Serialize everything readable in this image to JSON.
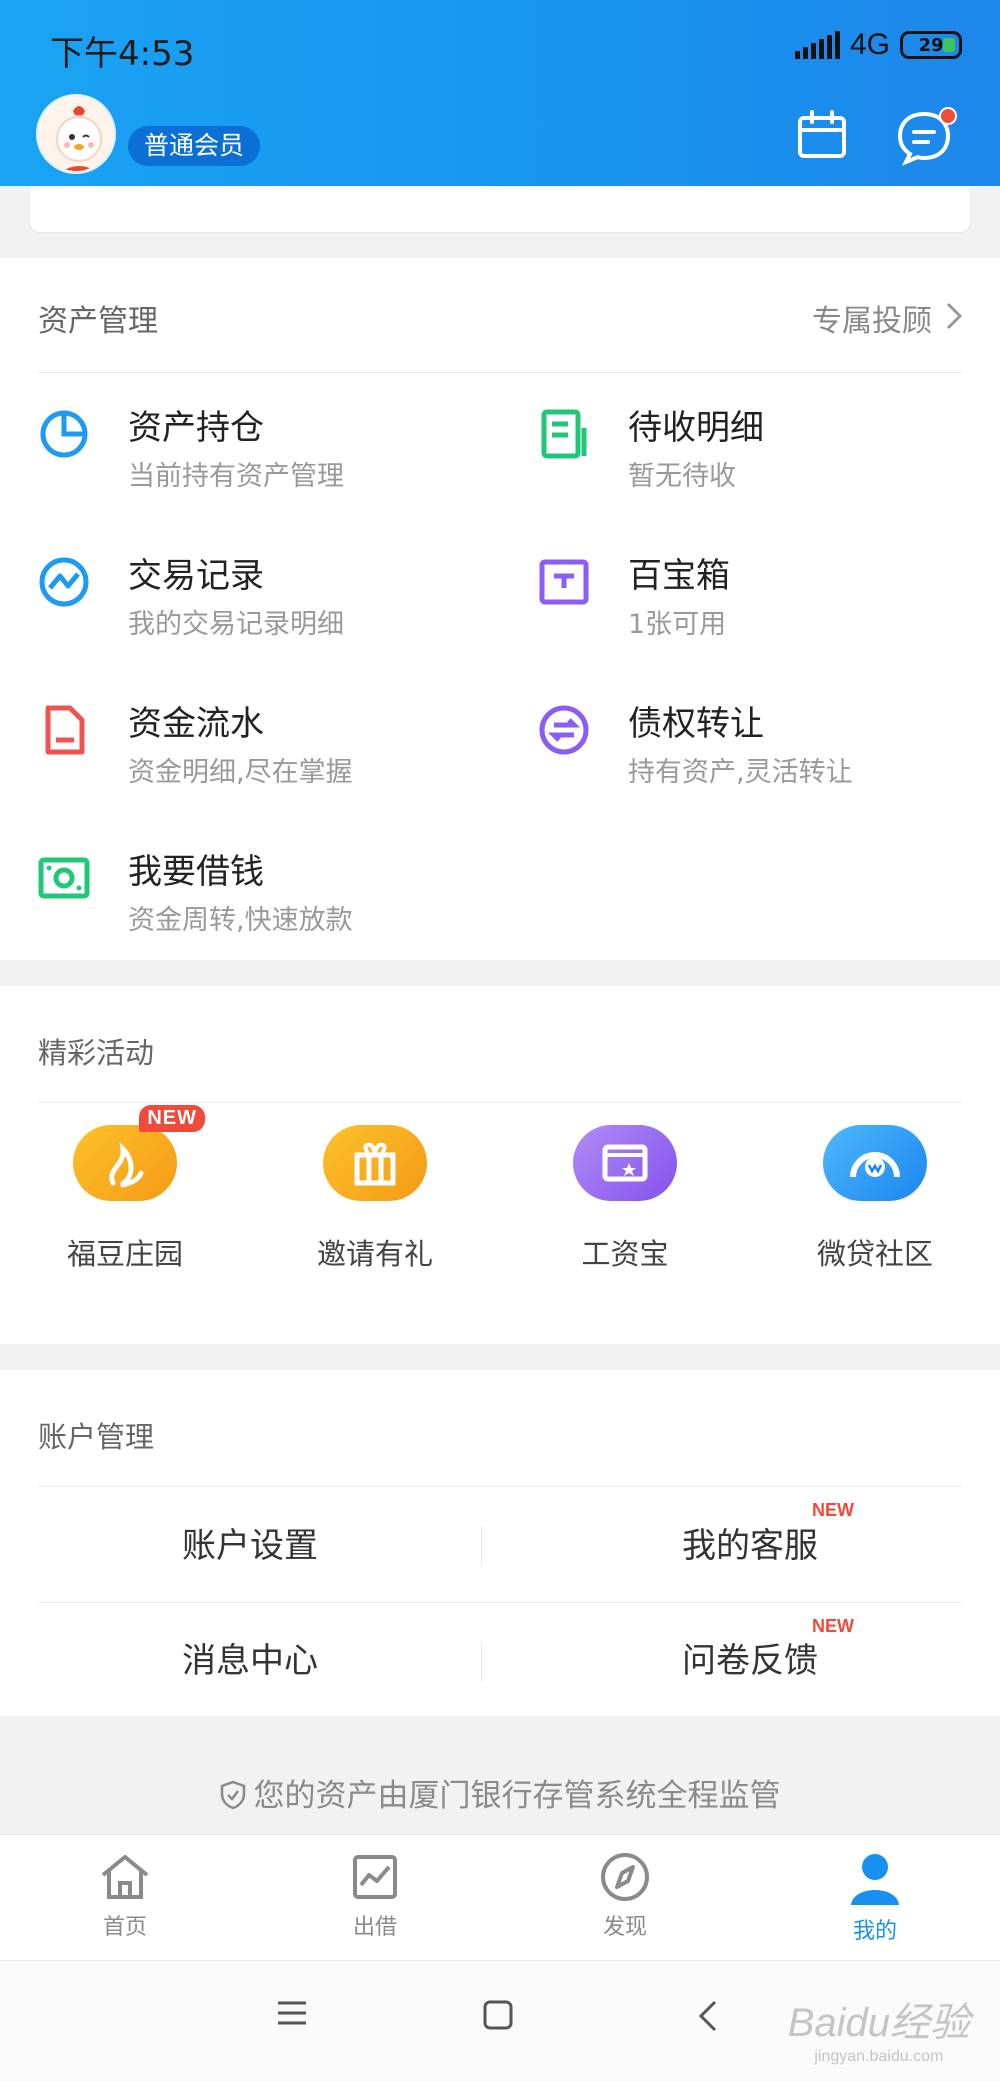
{
  "status_bar": {
    "time": "下午4:53",
    "network": "4G",
    "battery": "29"
  },
  "header": {
    "member_badge": "普通会员"
  },
  "asset_section": {
    "title": "资产管理",
    "advisor_link": "专属投顾",
    "items": [
      {
        "title": "资产持仓",
        "subtitle": "当前持有资产管理",
        "icon": "pie-chart-icon",
        "color": "#1e9bf0"
      },
      {
        "title": "待收明细",
        "subtitle": "暂无待收",
        "icon": "document-list-icon",
        "color": "#20c777"
      },
      {
        "title": "交易记录",
        "subtitle": "我的交易记录明细",
        "icon": "trend-line-icon",
        "color": "#1e9bf0"
      },
      {
        "title": "百宝箱",
        "subtitle": "1张可用",
        "icon": "coupon-box-icon",
        "color": "#8b5cf6"
      },
      {
        "title": "资金流水",
        "subtitle": "资金明细,尽在掌握",
        "icon": "file-icon",
        "color": "#ef5350"
      },
      {
        "title": "债权转让",
        "subtitle": "持有资产,灵活转让",
        "icon": "transfer-arrows-icon",
        "color": "#8b5cf6"
      },
      {
        "title": "我要借钱",
        "subtitle": "资金周转,快速放款",
        "icon": "cash-icon",
        "color": "#20c777"
      }
    ]
  },
  "activity_section": {
    "title": "精彩活动",
    "items": [
      {
        "label": "福豆庄园",
        "icon": "bean-farm-icon",
        "badge": "NEW",
        "color": "#f7a81b"
      },
      {
        "label": "邀请有礼",
        "icon": "gift-icon",
        "color": "#f7a81b"
      },
      {
        "label": "工资宝",
        "icon": "salary-card-icon",
        "color": "#9b6cf0"
      },
      {
        "label": "微贷社区",
        "icon": "community-icon",
        "color": "#1e9bf0"
      }
    ]
  },
  "account_section": {
    "title": "账户管理",
    "items": [
      {
        "label": "账户设置"
      },
      {
        "label": "我的客服",
        "badge": "NEW"
      },
      {
        "label": "消息中心"
      },
      {
        "label": "问卷反馈",
        "badge": "NEW"
      }
    ]
  },
  "footer_note": "您的资产由厦门银行存管系统全程监管",
  "tabbar": {
    "items": [
      {
        "label": "首页",
        "icon": "home-icon"
      },
      {
        "label": "出借",
        "icon": "chart-icon"
      },
      {
        "label": "发现",
        "icon": "compass-icon"
      },
      {
        "label": "我的",
        "icon": "user-icon",
        "active": true
      }
    ]
  },
  "colors": {
    "brand_blue": "#1795ee",
    "accent_red": "#f04a3b"
  }
}
